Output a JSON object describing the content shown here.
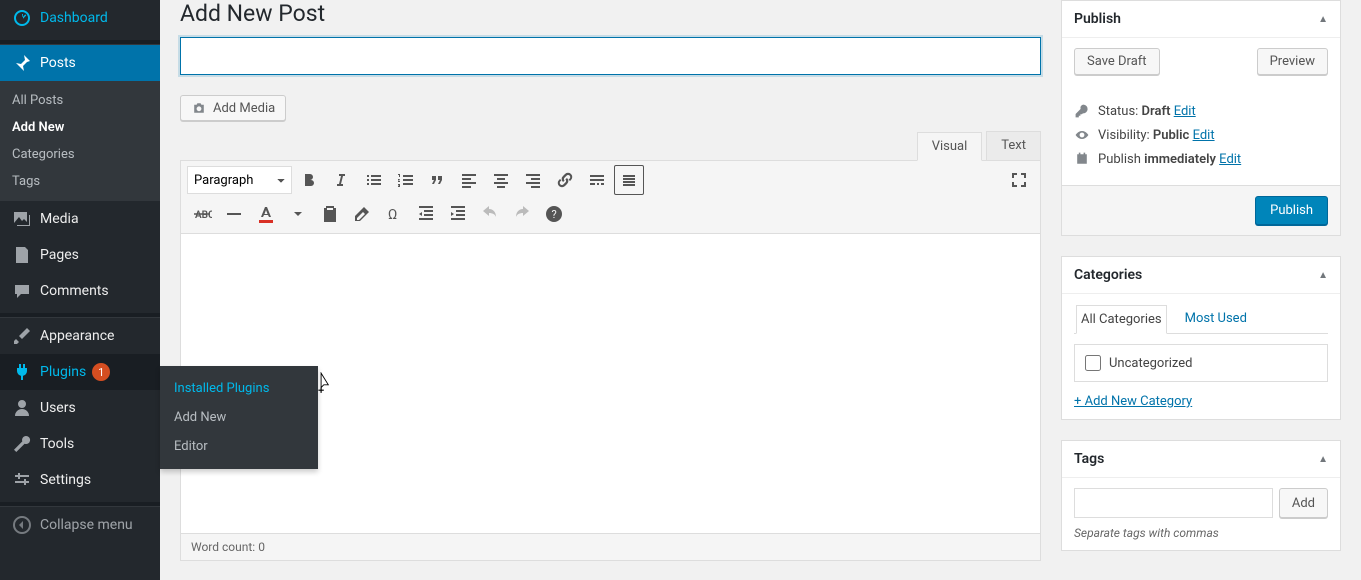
{
  "sidebar": {
    "dashboard": "Dashboard",
    "posts": "Posts",
    "posts_sub": {
      "all": "All Posts",
      "add": "Add New",
      "cat": "Categories",
      "tags": "Tags"
    },
    "media": "Media",
    "pages": "Pages",
    "comments": "Comments",
    "appearance": "Appearance",
    "plugins": "Plugins",
    "plugins_badge": "1",
    "users": "Users",
    "tools": "Tools",
    "settings": "Settings",
    "collapse": "Collapse menu"
  },
  "flyout": {
    "installed": "Installed Plugins",
    "add": "Add New",
    "editor": "Editor"
  },
  "page_title": "Add New Post",
  "title_value": "",
  "add_media": "Add Media",
  "tabs": {
    "visual": "Visual",
    "text": "Text"
  },
  "para_select": "Paragraph",
  "word_count_label": "Word count: ",
  "word_count_value": "0",
  "publish": {
    "title": "Publish",
    "save_draft": "Save Draft",
    "preview": "Preview",
    "status_label": "Status: ",
    "status_value": "Draft",
    "edit": "Edit",
    "visibility_label": "Visibility: ",
    "visibility_value": "Public",
    "publish_time_label": "Publish ",
    "publish_time_value": "immediately",
    "button": "Publish"
  },
  "categories": {
    "title": "Categories",
    "all": "All Categories",
    "most_used": "Most Used",
    "uncategorized": "Uncategorized",
    "add_new": "+ Add New Category"
  },
  "tags": {
    "title": "Tags",
    "add": "Add",
    "hint": "Separate tags with commas"
  }
}
